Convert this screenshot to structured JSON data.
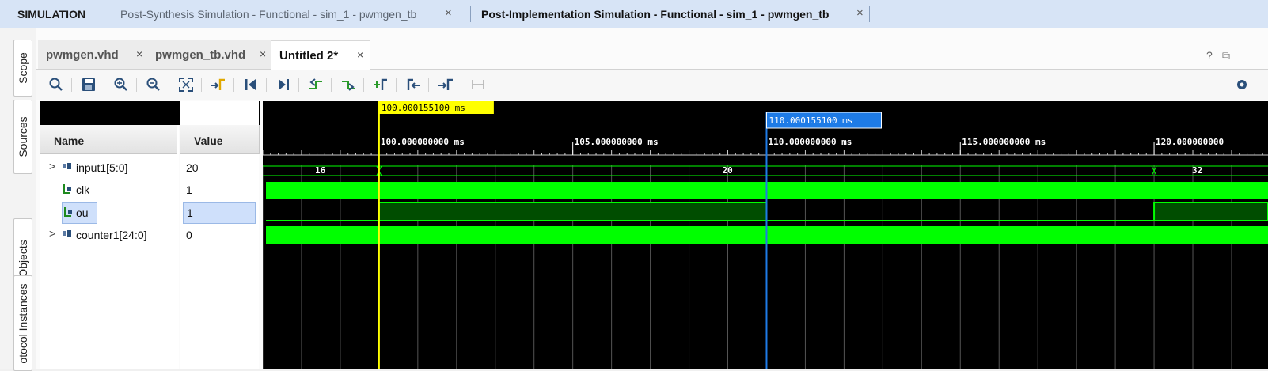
{
  "header": {
    "title": "SIMULATION",
    "tabs": [
      {
        "label": "Post-Synthesis Simulation - Functional - sim_1 - pwmgen_tb",
        "active": false
      },
      {
        "label": "Post-Implementation Simulation - Functional - sim_1 - pwmgen_tb",
        "active": true
      }
    ],
    "close_glyph": "×"
  },
  "side_tabs": [
    "Scope",
    "Sources",
    "Objects",
    "otocol Instances"
  ],
  "file_tabs": [
    {
      "label": "pwmgen.vhd",
      "active": false
    },
    {
      "label": "pwmgen_tb.vhd",
      "active": false
    },
    {
      "label": "Untitled 2*",
      "active": true
    }
  ],
  "top_right": {
    "help": "?",
    "restore": "⧉"
  },
  "toolbar_icons": [
    "search-icon",
    "save-icon",
    "zoom-in-icon",
    "zoom-out-icon",
    "zoom-fit-icon",
    "go-to-cursor-icon",
    "go-to-time-zero-icon",
    "go-to-last-time-icon",
    "previous-transition-icon",
    "next-transition-icon",
    "add-marker-icon",
    "previous-marker-icon",
    "next-marker-icon",
    "swap-cursors-icon"
  ],
  "columns": {
    "name": "Name",
    "value": "Value"
  },
  "signals": [
    {
      "name": "input1[5:0]",
      "value": "20",
      "kind": "bus",
      "expandable": true
    },
    {
      "name": "clk",
      "value": "1",
      "kind": "bit",
      "expandable": false
    },
    {
      "name": "ou",
      "value": "1",
      "kind": "bit",
      "expandable": false,
      "selected": true
    },
    {
      "name": "counter1[24:0]",
      "value": "0",
      "kind": "bus",
      "expandable": true
    }
  ],
  "cursors": {
    "main": {
      "label": "100.000155100 ms",
      "time_ms": 100.0001551,
      "color": "#ffff00"
    },
    "secondary": {
      "label": "110.000155100 ms",
      "time_ms": 110.0001551,
      "color": "#1e7be6"
    }
  },
  "timeline": {
    "major_labels": [
      "100.000000000 ms",
      "105.000000000 ms",
      "110.000000000 ms",
      "115.000000000 ms",
      "120.000000000"
    ],
    "major_times_ms": [
      100,
      105,
      110,
      115,
      120
    ],
    "view_start_ms": 97,
    "view_end_ms": 122.94
  },
  "bus_values": {
    "input1": [
      {
        "value": "16",
        "from_ms": 97,
        "to_ms": 100
      },
      {
        "value": "20",
        "from_ms": 100,
        "to_ms": 120
      },
      {
        "value": "32",
        "from_ms": 120,
        "to_ms": 122.94
      }
    ]
  },
  "ou_transitions": [
    {
      "from_ms": 100,
      "to_ms": 110,
      "level": 1
    },
    {
      "from_ms": 110,
      "to_ms": 120,
      "level": 0
    },
    {
      "from_ms": 120,
      "to_ms": 122.94,
      "level": 1
    }
  ],
  "colors": {
    "wave_green": "#00ff00",
    "wave_dark_green": "#004d00",
    "grid": "#555555"
  }
}
